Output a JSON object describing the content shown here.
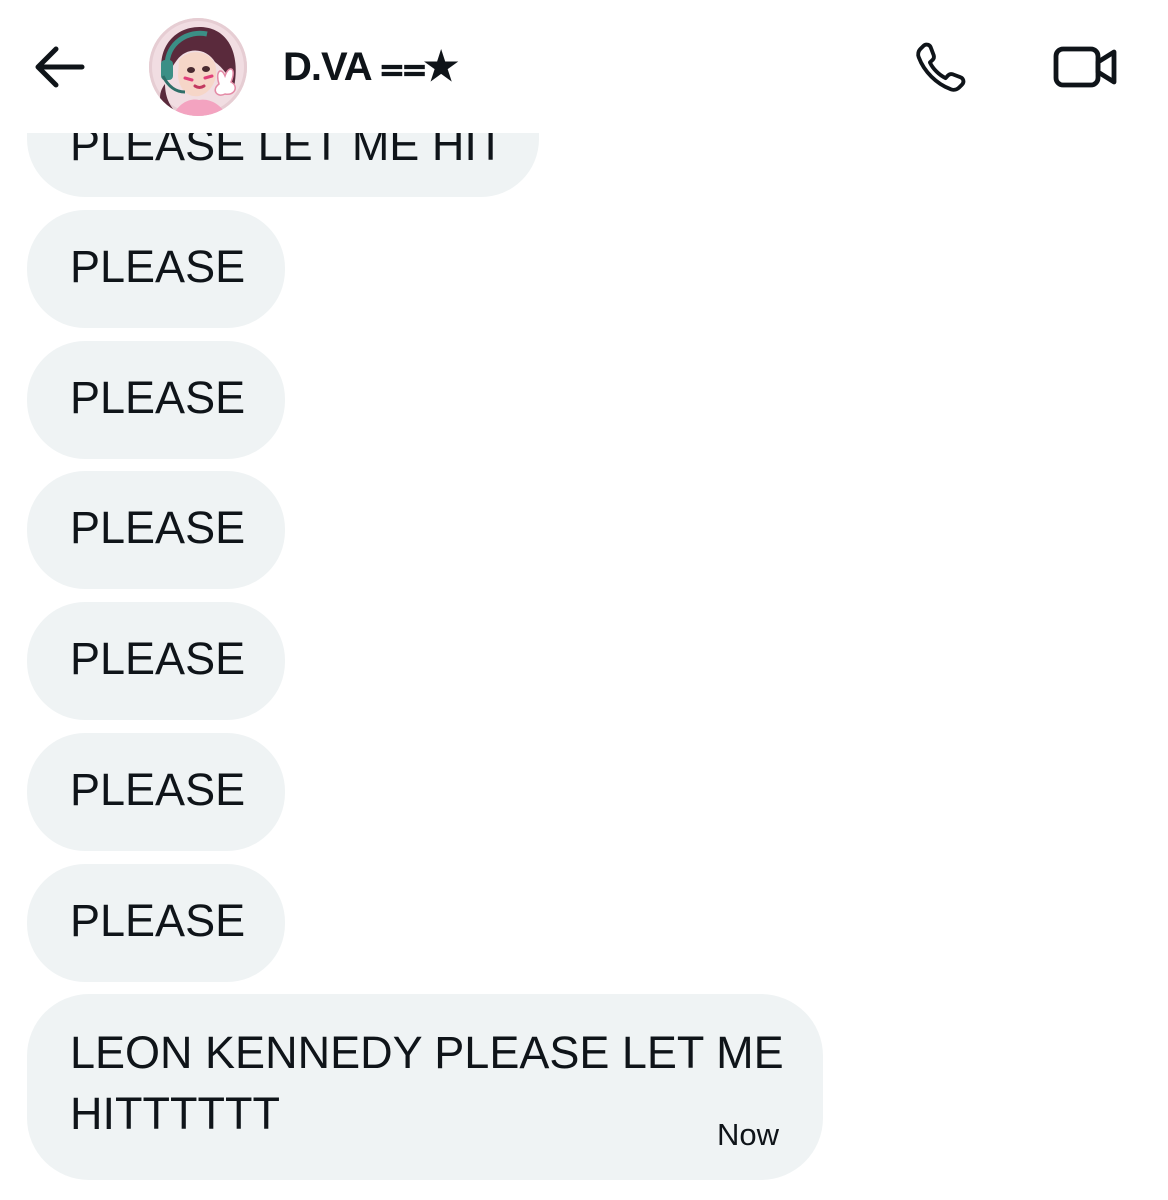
{
  "header": {
    "contact_name": "D.VA ⩵★",
    "back_icon": "arrow-left-icon",
    "call_icon": "phone-icon",
    "video_icon": "video-camera-icon"
  },
  "messages": [
    {
      "text": "PLEASE LET ME HIT"
    },
    {
      "text": "PLEASE"
    },
    {
      "text": "PLEASE"
    },
    {
      "text": "PLEASE"
    },
    {
      "text": "PLEASE"
    },
    {
      "text": "PLEASE"
    },
    {
      "text": "PLEASE"
    },
    {
      "text": "LEON KENNEDY PLEASE LET ME HITTTTTT",
      "time": "Now"
    }
  ],
  "colors": {
    "bubble_background": "#eff3f4",
    "text": "#0f1419",
    "page_background": "#ffffff"
  }
}
